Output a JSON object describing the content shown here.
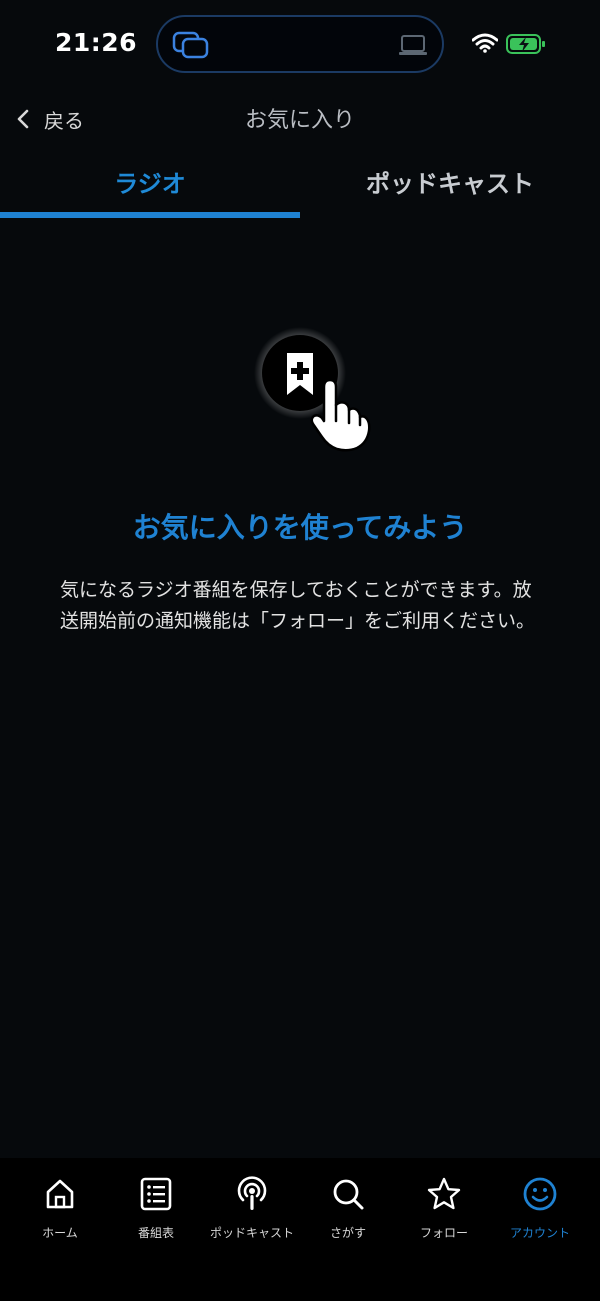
{
  "status": {
    "time": "21:26"
  },
  "header": {
    "back_label": "戻る",
    "title": "お気に入り"
  },
  "tabs": [
    {
      "label": "ラジオ",
      "active": true
    },
    {
      "label": "ポッドキャスト",
      "active": false
    }
  ],
  "empty_state": {
    "title": "お気に入りを使ってみよう",
    "description": "気になるラジオ番組を保存しておくことができます。放送開始前の通知機能は「フォロー」をご利用ください。"
  },
  "bottom_nav": [
    {
      "label": "ホーム",
      "icon": "home-icon",
      "active": false
    },
    {
      "label": "番組表",
      "icon": "program-list-icon",
      "active": false
    },
    {
      "label": "ポッドキャスト",
      "icon": "podcast-icon",
      "active": false
    },
    {
      "label": "さがす",
      "icon": "search-icon",
      "active": false
    },
    {
      "label": "フォロー",
      "icon": "star-icon",
      "active": false
    },
    {
      "label": "アカウント",
      "icon": "smiley-icon",
      "active": true
    }
  ],
  "colors": {
    "accent": "#1f82d2",
    "background": "#06090c"
  }
}
